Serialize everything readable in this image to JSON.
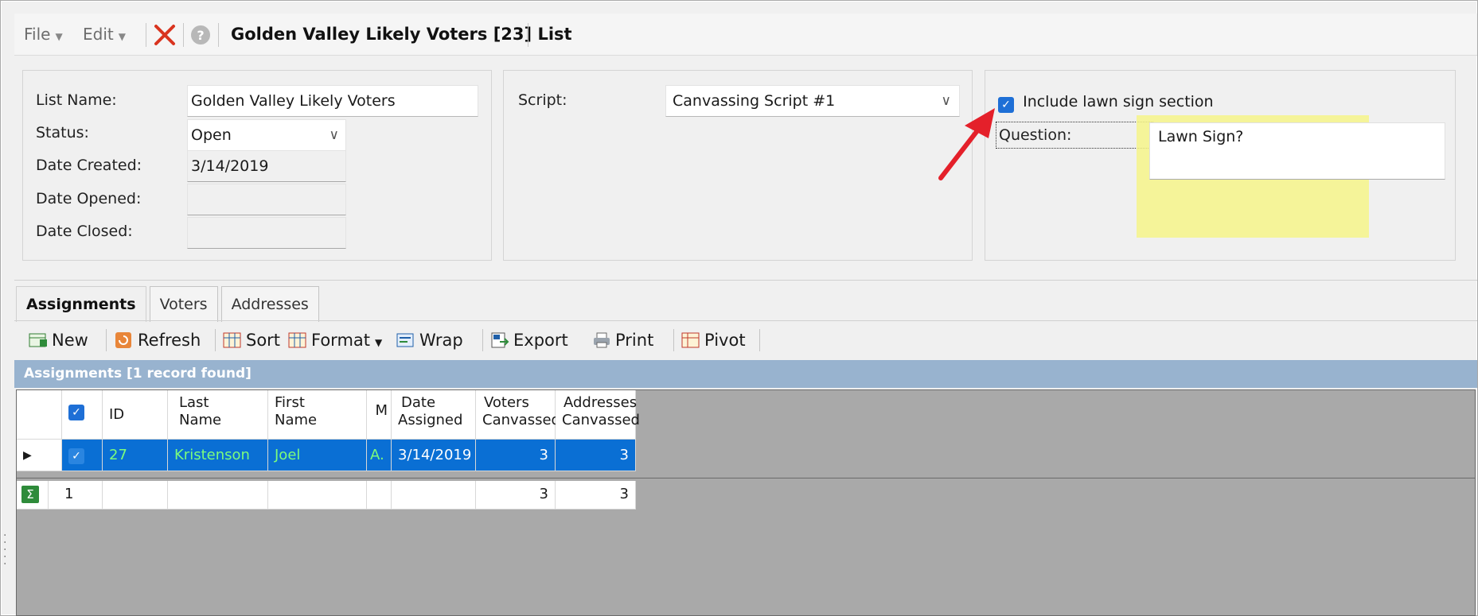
{
  "toolbar": {
    "file_label": "File",
    "edit_label": "Edit",
    "window_title": "Golden Valley Likely Voters [23] List"
  },
  "list_panel": {
    "list_name_label": "List Name:",
    "list_name_value": "Golden Valley Likely Voters",
    "status_label": "Status:",
    "status_value": "Open",
    "date_created_label": "Date Created:",
    "date_created_value": "3/14/2019",
    "date_opened_label": "Date Opened:",
    "date_opened_value": "",
    "date_closed_label": "Date Closed:",
    "date_closed_value": ""
  },
  "script_panel": {
    "script_label": "Script:",
    "script_value": "Canvassing Script #1"
  },
  "lawn_panel": {
    "include_label": "Include lawn sign section",
    "include_checked": true,
    "question_label": "Question:",
    "question_value": "Lawn Sign?"
  },
  "tabs": [
    {
      "label": "Assignments",
      "active": true
    },
    {
      "label": "Voters",
      "active": false
    },
    {
      "label": "Addresses",
      "active": false
    }
  ],
  "actions": {
    "new": "New",
    "refresh": "Refresh",
    "sort": "Sort",
    "format": "Format",
    "wrap": "Wrap",
    "export": "Export",
    "print": "Print",
    "pivot": "Pivot"
  },
  "grid": {
    "band_title": "Assignments [1 record found]",
    "columns": {
      "id": "ID",
      "last1": "Last",
      "last2": "Name",
      "first1": "First",
      "first2": "Name",
      "m": "M",
      "date1": "Date",
      "date2": "Assigned",
      "voters1": "Voters",
      "voters2": "Canvassed",
      "addr1": "Addresses",
      "addr2": "Canvassed"
    },
    "rows": [
      {
        "id": "27",
        "last": "Kristenson",
        "first": "Joel",
        "m": "A.",
        "date": "3/14/2019",
        "voters": "3",
        "addresses": "3"
      }
    ],
    "summary": {
      "count": "1",
      "voters": "3",
      "addresses": "3"
    }
  },
  "colors": {
    "selection_blue": "#0a6fd4",
    "selection_text": "#7CFC7C",
    "highlight_yellow": "#f6f58a",
    "arrow_red": "#e4202a"
  }
}
